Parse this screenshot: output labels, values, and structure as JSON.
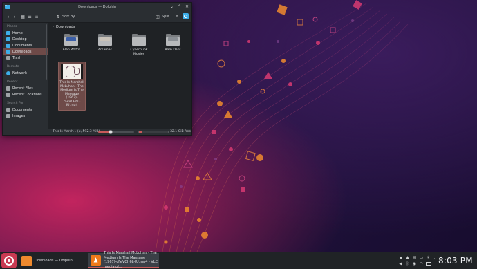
{
  "window": {
    "title": "Downloads — Dolphin"
  },
  "toolbar": {
    "sort_label": "Sort By",
    "split_label": "Split"
  },
  "sidebar": {
    "places_header": "Places",
    "places": [
      "Home",
      "Desktop",
      "Documents",
      "Downloads",
      "Trash"
    ],
    "active_index": 3,
    "remote_header": "Remote",
    "remote": [
      "Network"
    ],
    "recent_header": "Recent",
    "recent": [
      "Recent Files",
      "Recent Locations"
    ],
    "search_header": "Search For",
    "search": [
      "Documents",
      "Images"
    ]
  },
  "breadcrumb": {
    "location": "Downloads"
  },
  "files": [
    {
      "name": "Alan Watts",
      "kind": "folder",
      "emblem_color": "#3b5fa8"
    },
    {
      "name": "Arsamas",
      "kind": "folder",
      "emblem_color": "#c9c2b8"
    },
    {
      "name": "Cyberpunk Movies",
      "kind": "folder",
      "emblem_color": ""
    },
    {
      "name": "Ram Dass",
      "kind": "folder",
      "emblem_color": "#8a8f94"
    },
    {
      "name": "This Is Marshall McLuhan - The Medium Is The Massage (1967)-cFeVCH6L.JU.mp4",
      "display": "This Is Marshall McLuhan - The Medium Is The Massage (1967)-cFeVCH6L-JU.mp4",
      "kind": "video",
      "selected": true
    }
  ],
  "statusbar": {
    "text": "This Is Marsh... (u, 592.3 MiB)",
    "zoom_fraction": 0.35,
    "free_space": "32.1 GiB free",
    "used_fraction": 0.12
  },
  "taskbar": {
    "tasks": [
      {
        "label": "Downloads — Dolphin",
        "active": false
      },
      {
        "label": "This Is Marshall McLuhan - The Medium Is The Massage (1967)-cFeVCH6L-JU.mp4 - VLC media pl...",
        "active": true
      }
    ],
    "clock": "8:03 PM"
  },
  "colors": {
    "accent": "#3daee9",
    "selection": "#6e4a48",
    "progress": "#c85a5a"
  }
}
